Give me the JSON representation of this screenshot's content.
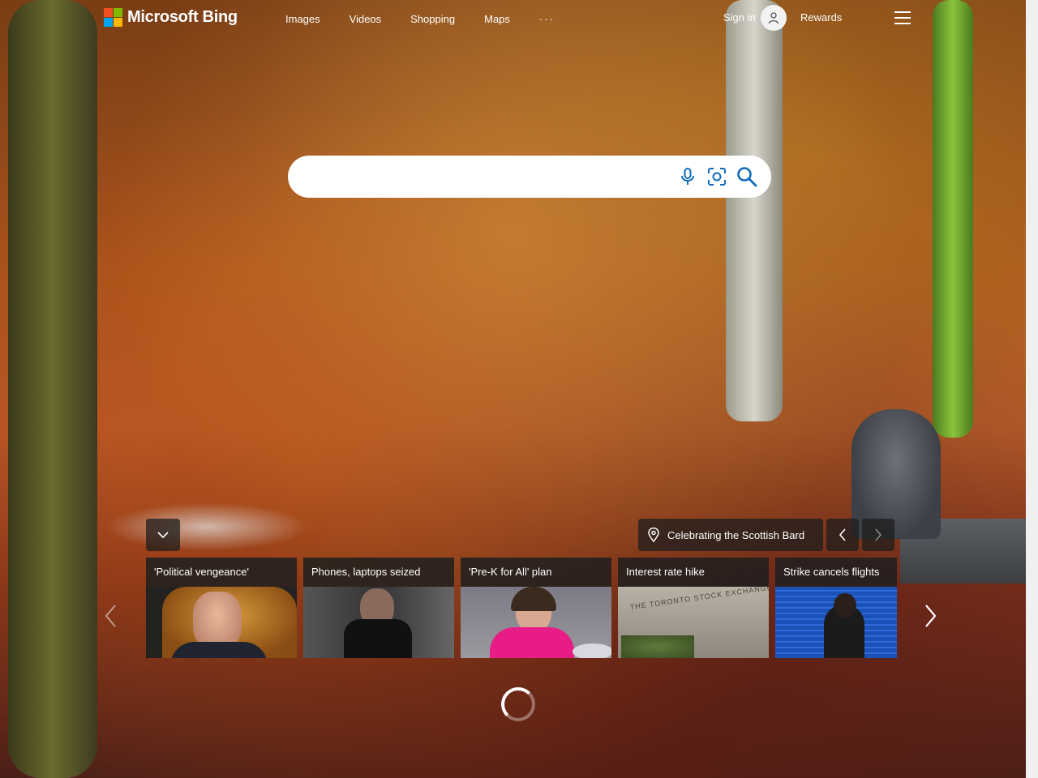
{
  "header": {
    "logo_text": "Microsoft Bing",
    "nav": [
      "Images",
      "Videos",
      "Shopping",
      "Maps"
    ],
    "more": "···",
    "sign_in": "Sign in",
    "rewards": "Rewards"
  },
  "search": {
    "value": "",
    "placeholder": ""
  },
  "image_caption": "Celebrating the Scottish Bard",
  "news": [
    {
      "title": "'Political vengeance'"
    },
    {
      "title": "Phones, laptops seized"
    },
    {
      "title": "'Pre-K for All' plan"
    },
    {
      "title": "Interest rate hike"
    },
    {
      "title": "Strike cancels flights"
    }
  ],
  "thumb_texts": {
    "exchange": "THE TORONTO STOCK EXCHANGE"
  },
  "colors": {
    "ms_red": "#f25022",
    "ms_green": "#7fba00",
    "ms_blue": "#00a4ef",
    "ms_yellow": "#ffb900",
    "search_icon": "#0f6cbd"
  }
}
